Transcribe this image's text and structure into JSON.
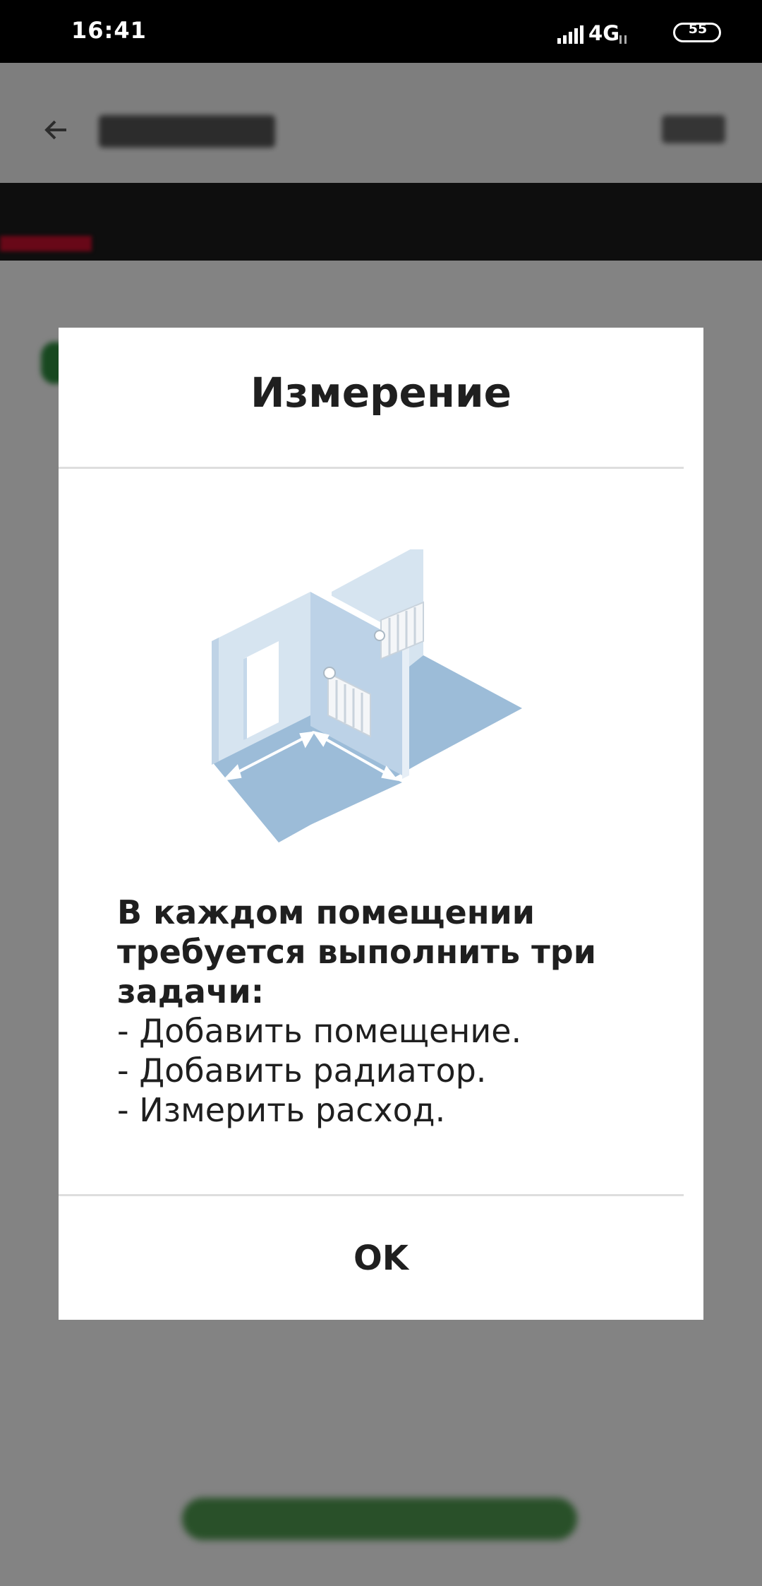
{
  "status_bar": {
    "time": "16:41",
    "network_type": "4G",
    "battery_level": "55",
    "icons": [
      "signal-icon",
      "battery-icon"
    ]
  },
  "dialog": {
    "title": "Измерение",
    "illustration_icon": "room-measurement-illustration",
    "message_heading_lines": [
      "В каждом помещении",
      "требуется выполнить три",
      "задачи:"
    ],
    "message_items": [
      "- Добавить помещение.",
      "- Добавить радиатор.",
      "- Измерить расход."
    ],
    "ok_label": "OK"
  },
  "colors": {
    "scrim": "#000000",
    "dialog_bg": "#ffffff",
    "accent_red": "#c8102e",
    "accent_green": "#4f9a4f",
    "illustration_floor": "#9cbcd8",
    "illustration_wall": "#d6e4f0"
  }
}
